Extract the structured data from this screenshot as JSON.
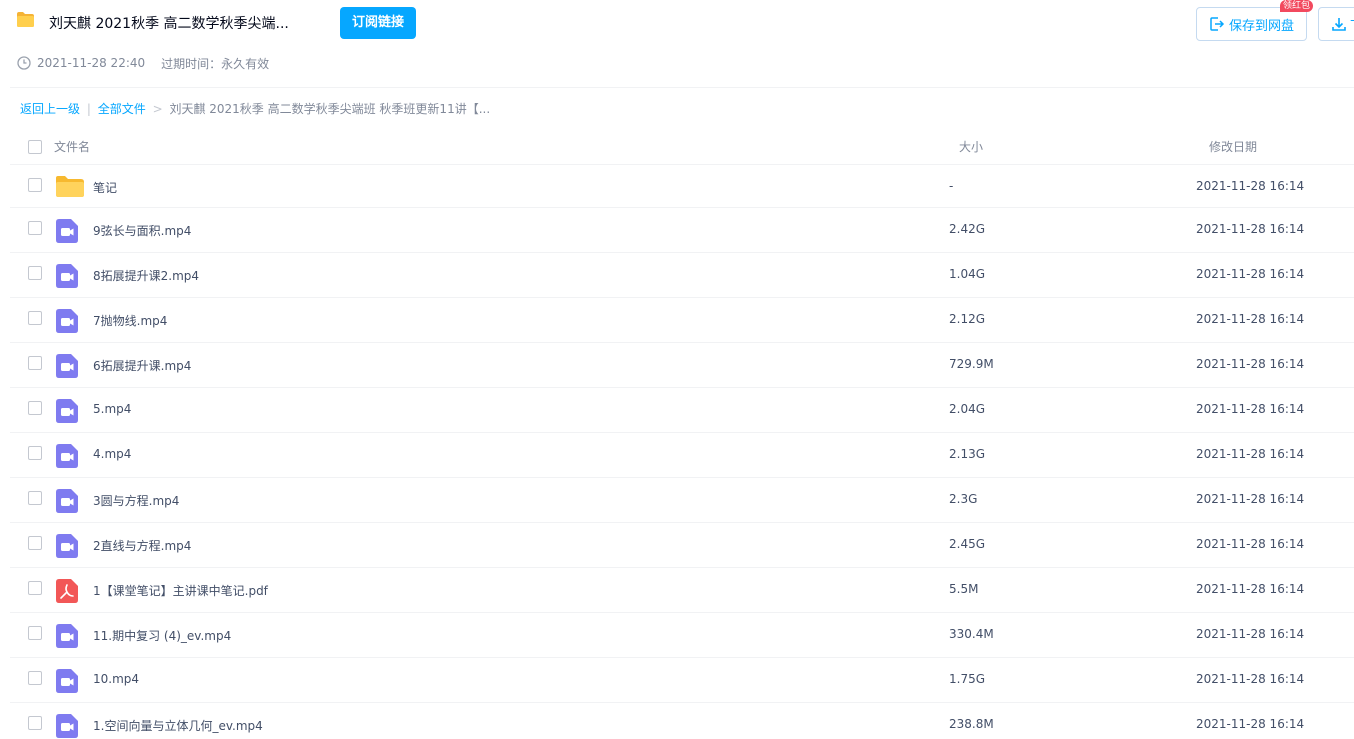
{
  "header": {
    "title": "刘天麒 2021秋季 高二数学秋季尖端...",
    "subscribe_label": "订阅链接",
    "created": "2021-11-28 22:40",
    "expire": "过期时间：永久有效",
    "save_label": "保存到网盘",
    "save_badge": "领红包",
    "download_label": "下"
  },
  "breadcrumb": {
    "back": "返回上一级",
    "sep1": "|",
    "all": "全部文件",
    "sep2": ">",
    "current": "刘天麒 2021秋季 高二数学秋季尖端班 秋季班更新11讲【..."
  },
  "table": {
    "col_name": "文件名",
    "col_size": "大小",
    "col_date": "修改日期"
  },
  "files": [
    {
      "name": "笔记",
      "size": "-",
      "date": "2021-11-28 16:14",
      "type": "folder"
    },
    {
      "name": "9弦长与面积.mp4",
      "size": "2.42G",
      "date": "2021-11-28 16:14",
      "type": "video"
    },
    {
      "name": "8拓展提升课2.mp4",
      "size": "1.04G",
      "date": "2021-11-28 16:14",
      "type": "video"
    },
    {
      "name": "7抛物线.mp4",
      "size": "2.12G",
      "date": "2021-11-28 16:14",
      "type": "video"
    },
    {
      "name": "6拓展提升课.mp4",
      "size": "729.9M",
      "date": "2021-11-28 16:14",
      "type": "video"
    },
    {
      "name": "5.mp4",
      "size": "2.04G",
      "date": "2021-11-28 16:14",
      "type": "video"
    },
    {
      "name": "4.mp4",
      "size": "2.13G",
      "date": "2021-11-28 16:14",
      "type": "video"
    },
    {
      "name": "3圆与方程.mp4",
      "size": "2.3G",
      "date": "2021-11-28 16:14",
      "type": "video"
    },
    {
      "name": "2直线与方程.mp4",
      "size": "2.45G",
      "date": "2021-11-28 16:14",
      "type": "video"
    },
    {
      "name": "1【课堂笔记】主讲课中笔记.pdf",
      "size": "5.5M",
      "date": "2021-11-28 16:14",
      "type": "pdf"
    },
    {
      "name": "11.期中复习 (4)_ev.mp4",
      "size": "330.4M",
      "date": "2021-11-28 16:14",
      "type": "video"
    },
    {
      "name": "10.mp4",
      "size": "1.75G",
      "date": "2021-11-28 16:14",
      "type": "video"
    },
    {
      "name": "1.空间向量与立体几何_ev.mp4",
      "size": "238.8M",
      "date": "2021-11-28 16:14",
      "type": "video"
    }
  ],
  "colors": {
    "accent": "#06a7ff",
    "folder": "#ffcf4d",
    "video": "#7f7bf0",
    "pdf": "#f25757",
    "badge": "#f2495e"
  }
}
